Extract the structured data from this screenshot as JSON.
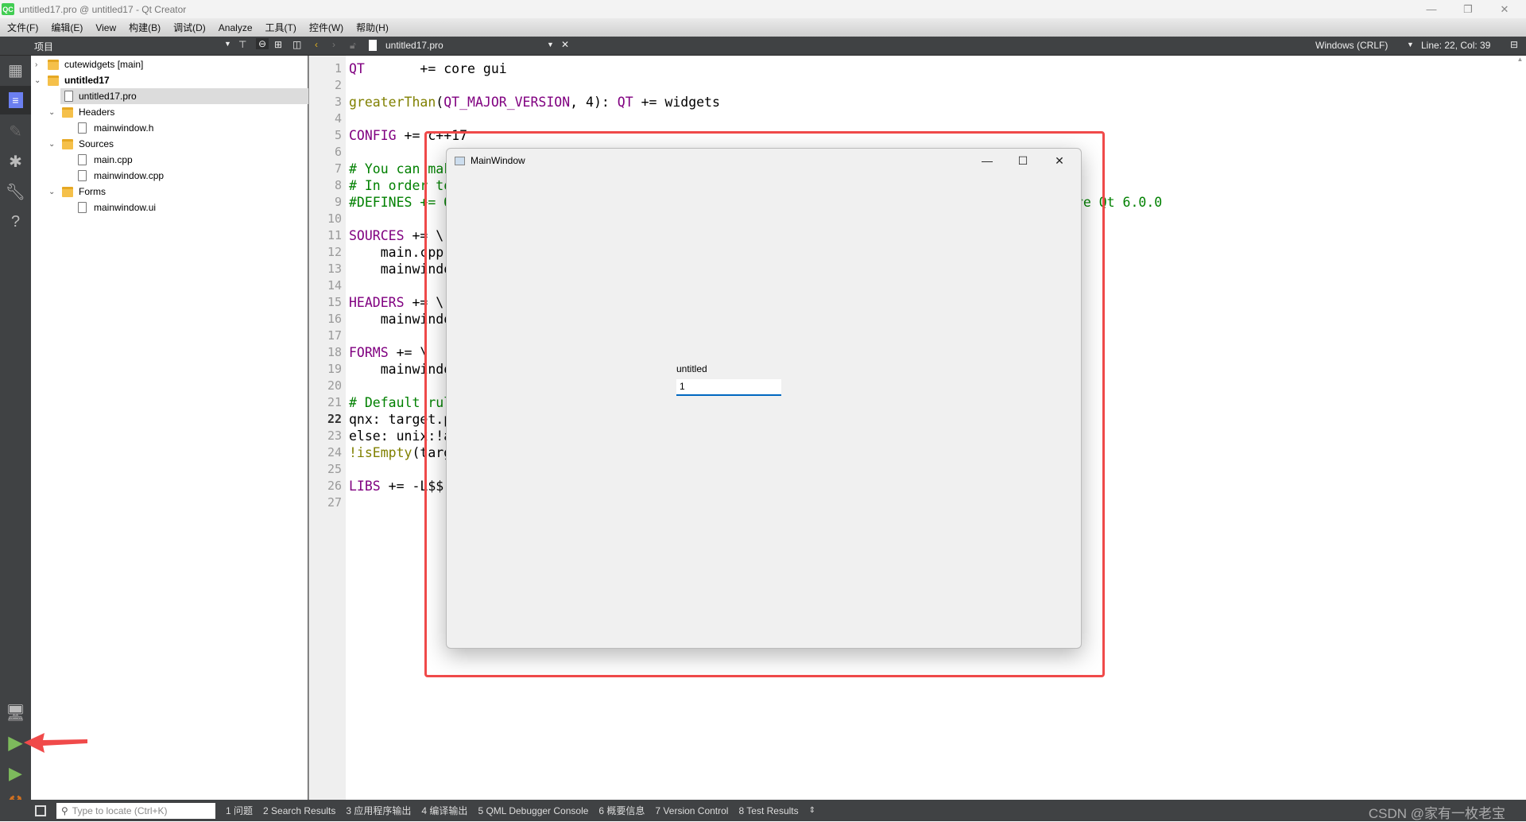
{
  "window": {
    "title": "untitled17.pro @ untitled17 - Qt Creator",
    "logo": "QC"
  },
  "menu": [
    "文件(F)",
    "编辑(E)",
    "View",
    "构建(B)",
    "调试(D)",
    "Analyze",
    "工具(T)",
    "控件(W)",
    "帮助(H)"
  ],
  "toolbar": {
    "project_selector": "项目",
    "open_file": "untitled17.pro",
    "line_ending": "Windows (CRLF)",
    "cursor_pos": "Line: 22, Col: 39"
  },
  "tree": [
    {
      "label": "cutewidgets [main]",
      "bold": false
    },
    {
      "label": "untitled17",
      "bold": true
    },
    {
      "label": "untitled17.pro"
    },
    {
      "label": "Headers"
    },
    {
      "label": "mainwindow.h"
    },
    {
      "label": "Sources"
    },
    {
      "label": "main.cpp"
    },
    {
      "label": "mainwindow.cpp"
    },
    {
      "label": "Forms"
    },
    {
      "label": "mainwindow.ui"
    }
  ],
  "code": [
    "QT       += core gui",
    "",
    "greaterThan(QT_MAJOR_VERSION, 4): QT += widgets",
    "",
    "CONFIG += c++17",
    "",
    "# You can make your code fail to compile if it uses deprecated APIs.",
    "# In order to do so, uncomment the following line.",
    "#DEFINES += QT_DISABLE_DEPRECATED_BEFORE=0x060000    # disables all the APIs deprecated before Qt 6.0.0",
    "",
    "SOURCES += \\",
    "    main.cpp \\",
    "    mainwindow.cpp",
    "",
    "HEADERS += \\",
    "    mainwindow.h",
    "",
    "FORMS += \\",
    "    mainwindow.ui",
    "",
    "# Default rules for deployment.",
    "qnx: target.path = /tmp/$${TARGET}/bin",
    "else: unix:!android: target.path = /opt/$${TARGET}/bin",
    "!isEmpty(target.path): INSTALLS += target",
    "",
    "LIBS += -L$$",
    ""
  ],
  "current_line": 22,
  "bottom": {
    "locate_placeholder": "Type to locate (Ctrl+K)",
    "tabs": [
      "1 问题",
      "2 Search Results",
      "3 应用程序输出",
      "4 编译输出",
      "5 QML Debugger Console",
      "6 概要信息",
      "7 Version Control",
      "8 Test Results"
    ]
  },
  "app_window": {
    "title": "MainWindow",
    "label": "untitled",
    "input_value": "1"
  },
  "watermark": "CSDN @家有一枚老宝",
  "colors": {
    "keyword": "#800080",
    "function": "#808000",
    "comment": "#008000",
    "highlight": "#f04a4a",
    "run": "#7dbb5c"
  }
}
